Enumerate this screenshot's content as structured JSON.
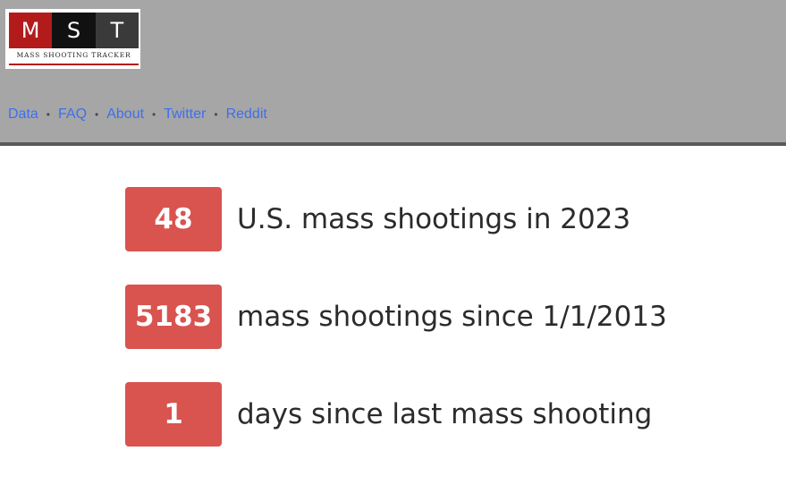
{
  "logo": {
    "letters": [
      "M",
      "S",
      "T"
    ],
    "subtitle": "Mass Shooting Tracker"
  },
  "nav": {
    "items": [
      "Data",
      "FAQ",
      "About",
      "Twitter",
      "Reddit"
    ],
    "separator": "•"
  },
  "stats": [
    {
      "value": "48",
      "label": "U.S. mass shootings in 2023"
    },
    {
      "value": "5183",
      "label": "mass shootings since 1/1/2013"
    },
    {
      "value": "1",
      "label": "days since last mass shooting"
    }
  ],
  "colors": {
    "header_bg": "#a6a6a6",
    "badge": "#d9534f",
    "link": "#3d6ff0",
    "logo_red": "#b31b1b"
  }
}
